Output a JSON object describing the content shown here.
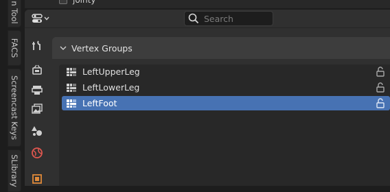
{
  "tabs": [
    "n Tool",
    "FACS",
    "Screencast Keys",
    "SLibrary"
  ],
  "top_row": {
    "label": "jointy"
  },
  "header": {
    "search_placeholder": "Search"
  },
  "panel": {
    "title": "Vertex Groups",
    "groups": [
      {
        "label": "LeftUpperLeg",
        "selected": false
      },
      {
        "label": "LeftLowerLeg",
        "selected": false
      },
      {
        "label": "LeftFoot",
        "selected": true
      }
    ]
  },
  "side_icons": [
    "tool-icon",
    "render-icon",
    "output-icon",
    "view-layer-icon",
    "scene-icon",
    "world-icon",
    "object-icon"
  ],
  "colors": {
    "selection": "#4772b3",
    "background": "#303030"
  }
}
